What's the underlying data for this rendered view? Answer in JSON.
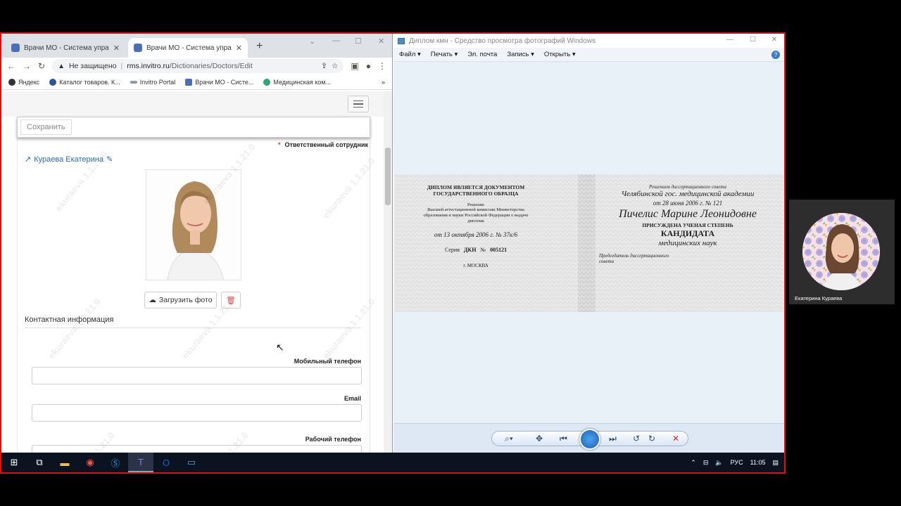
{
  "browser": {
    "tabs": [
      {
        "title": "Врачи МО - Система управления"
      },
      {
        "title": "Врачи МО - Система управления"
      }
    ],
    "new_tab_glyph": "+",
    "address": {
      "security": "Не защищено",
      "host": "rms.invitro.ru",
      "path": "/Dictionaries/Doctors/Edit"
    },
    "bookmarks": [
      {
        "label": "Яндекс",
        "icon": "yandex-icon"
      },
      {
        "label": "Каталог товаров. К...",
        "icon": "catalog-icon"
      },
      {
        "label": "Invitro Portal",
        "icon": "invitro-icon"
      },
      {
        "label": "Врачи МО - Систе...",
        "icon": "doctors-icon"
      },
      {
        "label": "Медицинская ком...",
        "icon": "medical-icon"
      }
    ],
    "bookmarks_more": "»"
  },
  "form": {
    "save_label": "Сохранить",
    "responsible_label": "Ответственный сотрудник",
    "required_marker": "*",
    "user_name": "Кураева Екатерина",
    "upload_label": "Загрузить фото",
    "contact_section": "Контактная информация",
    "fields": [
      {
        "label": "Мобильный телефон",
        "value": ""
      },
      {
        "label": "Email",
        "value": ""
      },
      {
        "label": "Рабочий телефон",
        "value": ""
      }
    ],
    "watermark": "ekuraeva 1.1.21.0"
  },
  "viewer": {
    "title": "Диплом кмн - Средство просмотра фотографий Windows",
    "menu": [
      "Файл ▾",
      "Печать ▾",
      "Эл. почта",
      "Запись ▾",
      "Открыть ▾"
    ],
    "help_glyph": "?",
    "diploma": {
      "left_heading": "ДИПЛОМ ЯВЛЯЕТСЯ ДОКУМЕНТОМ ГОСУДАРСТВЕННОГО ОБРАЗЦА",
      "left_decision": "Решение",
      "left_body": "Высшей аттестационной комиссии Министерства образования и науки Российской Федерации о выдаче диплома",
      "left_date": "от 13 октября 2006 г. № 37к/6",
      "series_label": "Серия",
      "series": "ДКН",
      "number_label": "№",
      "number": "005121",
      "city": "г. МОСКВА",
      "right_decision": "Решением диссертационного совета",
      "right_academy": "Челябинской гос. медицинской академии",
      "right_date": "от 28 июня 2006 г. № 121",
      "name": "Пичелис Марине Леонидовне",
      "awarded": "ПРИСУЖДЕНА УЧЕНАЯ СТЕПЕНЬ",
      "degree": "КАНДИДАТА",
      "field": "медицинских наук",
      "chair": "Председатель диссертационного совета"
    }
  },
  "taskbar": {
    "lang": "РУС",
    "time": "11:05"
  },
  "webcam": {
    "name": "Екатерина Кураева"
  }
}
